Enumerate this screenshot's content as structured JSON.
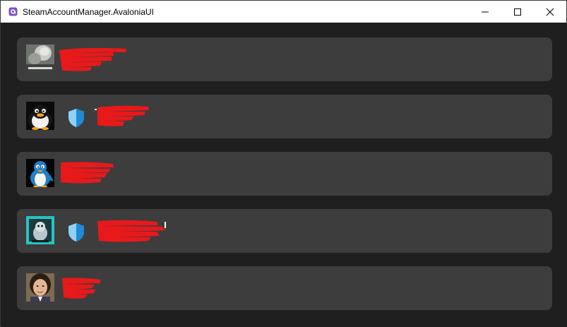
{
  "window": {
    "title": "SteamAccountManager.AvaloniaUI"
  },
  "colors": {
    "titlebar": "#ffffff",
    "background": "#1f1f1f",
    "card": "#3d3d3d",
    "redaction": "#e8191b",
    "shield_light": "#8fd0f5",
    "shield_dark": "#1f8ad6",
    "app_icon": "#7b4fc4"
  },
  "caption_buttons": [
    "minimize-icon",
    "maximize-icon",
    "close-icon"
  ],
  "accounts": [
    {
      "avatar": "silent-hill-avatar",
      "guard": false,
      "name": ""
    },
    {
      "avatar": "penguin-avatar",
      "guard": true,
      "name": ""
    },
    {
      "avatar": "blue-penguin-avatar",
      "guard": false,
      "name": ""
    },
    {
      "avatar": "teal-creature-avatar",
      "guard": true,
      "name": ""
    },
    {
      "avatar": "person-photo-avatar",
      "guard": false,
      "name": ""
    }
  ]
}
